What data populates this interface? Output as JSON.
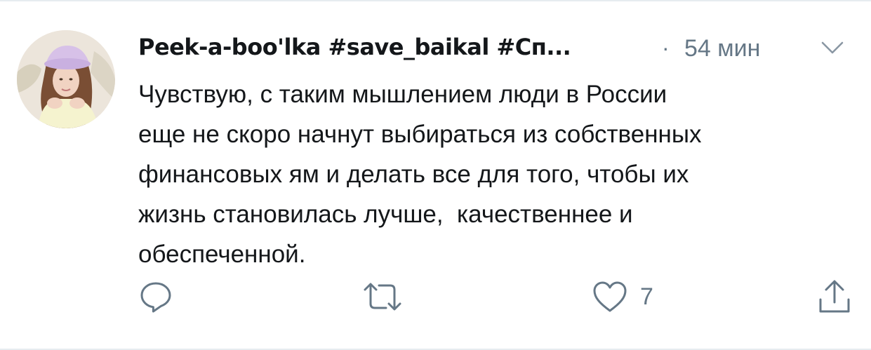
{
  "tweet": {
    "author_name": "Peek-a-boo'lka #save_baikal #Сп...",
    "separator": "·",
    "timestamp": "54 мин",
    "text": "Чувствую, с таким мышлением люди в России\nеще не скоро начнут выбираться из собственных\nфинансовых ям и делать все для того, чтобы их\nжизнь становилась лучше,  качественнее и\nобеспеченной.",
    "like_count": "7"
  },
  "icons": {
    "reply": "reply-icon",
    "retweet": "retweet-icon",
    "like": "heart-icon",
    "share": "share-icon",
    "menu": "chevron-down-icon"
  },
  "colors": {
    "text": "#14171a",
    "secondary": "#657786",
    "divider": "#e6ecf0"
  }
}
